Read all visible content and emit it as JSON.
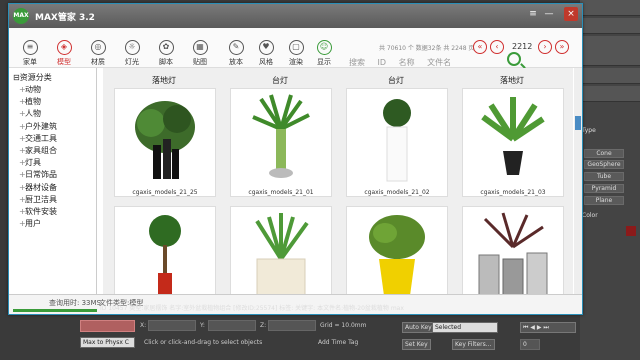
{
  "app": {
    "logo": "MAX",
    "title": "MAX管家 3.2"
  },
  "window_controls": {
    "menu": "≡",
    "minimize": "—",
    "maximize": "□",
    "close": "×"
  },
  "toolbar": {
    "tools": [
      {
        "label": "家单",
        "icon": "≡"
      },
      {
        "label": "模型",
        "icon": "◈"
      },
      {
        "label": "材质",
        "icon": "◎"
      },
      {
        "label": "灯光",
        "icon": "☼"
      },
      {
        "label": "脚本",
        "icon": "✿"
      },
      {
        "label": "贴图",
        "icon": "▦"
      },
      {
        "label": "放本",
        "icon": "✎"
      },
      {
        "label": "风格",
        "icon": "♥"
      },
      {
        "label": "渲染",
        "icon": "▢"
      },
      {
        "label": "显示",
        "icon": "☺"
      }
    ],
    "stats": "共 70610 个 数据32条 共 2248 页",
    "search": {
      "placeholder": "搜索",
      "id": "ID",
      "name": "名称",
      "file": "文件名"
    },
    "page": "2212"
  },
  "tree": {
    "root": "资源分类",
    "items": [
      "动物",
      "植物",
      "人物",
      "户外建筑",
      "交通工具",
      "家具组合",
      "灯具",
      "日常饰品",
      "器材设备",
      "厨卫洁具",
      "软件安装",
      "用户"
    ]
  },
  "grid": {
    "headers": [
      "落地灯",
      "台灯",
      "台灯",
      "落地灯"
    ],
    "cards": [
      {
        "name": "cgaxis_models_21_25"
      },
      {
        "name": "cgaxis_models_21_01"
      },
      {
        "name": "cgaxis_models_21_02"
      },
      {
        "name": "cgaxis_models_21_03"
      },
      {
        "name": ""
      },
      {
        "name": ""
      },
      {
        "name": ""
      },
      {
        "name": ""
      }
    ]
  },
  "status": {
    "left": "查询用时: 33MS",
    "type": "文件类型:模型",
    "id_line": "ID 10457  类型:家居摆饰  名字:室外盆栽植物组合  [修改ID:25574]  标签:  关键字:  本文件名:植物-20盆栽植物  max"
  },
  "host": {
    "right_labels": [
      "Type",
      "Cone",
      "GeoSphere",
      "Tube",
      "Pyramid",
      "Plane",
      "Color"
    ],
    "bottom": {
      "x_label": "X:",
      "y_label": "Y:",
      "z_label": "Z:",
      "grid": "Grid = 10.0mm",
      "auto_key": "Auto Key",
      "selected": "Selected",
      "set_key": "Set Key",
      "key_filters": "Key Filters...",
      "max_to_physx": "Max to Physx C",
      "prompt": "Click or click-and-drag to select objects",
      "add_time_tag": "Add Time Tag",
      "frame": "0"
    }
  },
  "colors": {
    "accent": "#d03030",
    "brand": "#3a9b3a",
    "frame": "#2a8fb8"
  }
}
